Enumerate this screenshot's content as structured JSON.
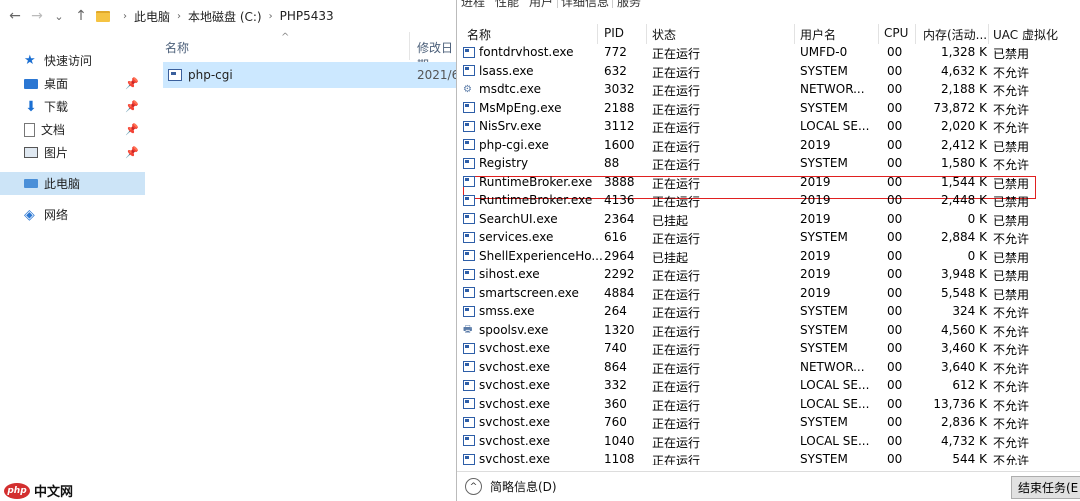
{
  "explorer": {
    "nav_back": "←",
    "nav_forward": "→",
    "nav_dropdown": "⌄",
    "nav_up": "↑",
    "breadcrumb": [
      "此电脑",
      "本地磁盘 (C:)",
      "PHP5433"
    ],
    "breadcrumb_sep": "›",
    "sidebar": [
      {
        "label": "快速访问",
        "icon": "star-icon"
      },
      {
        "label": "桌面",
        "icon": "desktop-icon",
        "pinned": true
      },
      {
        "label": "下载",
        "icon": "download-icon",
        "pinned": true
      },
      {
        "label": "文档",
        "icon": "document-icon",
        "pinned": true
      },
      {
        "label": "图片",
        "icon": "picture-icon",
        "pinned": true
      },
      {
        "label": "此电脑",
        "icon": "computer-icon",
        "selected": true
      },
      {
        "label": "网络",
        "icon": "network-icon"
      }
    ],
    "columns": {
      "name": "名称",
      "date": "修改日期"
    },
    "sort_indicator": "^",
    "pin_glyph": "📌",
    "files": [
      {
        "name": "php-cgi",
        "date": "2021/6"
      }
    ]
  },
  "taskmgr": {
    "tabs": [
      "进程",
      "性能",
      "用户",
      "详细信息",
      "服务"
    ],
    "active_tab": "详细信息",
    "columns": [
      "名称",
      "PID",
      "状态",
      "用户名",
      "CPU",
      "内存(活动...",
      "UAC 虚拟化"
    ],
    "rows": [
      {
        "name": "fontdrvhost.exe",
        "pid": "772",
        "status": "正在运行",
        "user": "UMFD-0",
        "cpu": "00",
        "mem": "1,328 K",
        "uac": "已禁用",
        "icon": "process-icon"
      },
      {
        "name": "lsass.exe",
        "pid": "632",
        "status": "正在运行",
        "user": "SYSTEM",
        "cpu": "00",
        "mem": "4,632 K",
        "uac": "不允许",
        "icon": "process-icon"
      },
      {
        "name": "msdtc.exe",
        "pid": "3032",
        "status": "正在运行",
        "user": "NETWOR...",
        "cpu": "00",
        "mem": "2,188 K",
        "uac": "不允许",
        "icon": "service-icon"
      },
      {
        "name": "MsMpEng.exe",
        "pid": "2188",
        "status": "正在运行",
        "user": "SYSTEM",
        "cpu": "00",
        "mem": "73,872 K",
        "uac": "不允许",
        "icon": "process-icon"
      },
      {
        "name": "NisSrv.exe",
        "pid": "3112",
        "status": "正在运行",
        "user": "LOCAL SE...",
        "cpu": "00",
        "mem": "2,020 K",
        "uac": "不允许",
        "icon": "process-icon"
      },
      {
        "name": "php-cgi.exe",
        "pid": "1600",
        "status": "正在运行",
        "user": "2019",
        "cpu": "00",
        "mem": "2,412 K",
        "uac": "已禁用",
        "icon": "process-icon",
        "highlighted": true
      },
      {
        "name": "Registry",
        "pid": "88",
        "status": "正在运行",
        "user": "SYSTEM",
        "cpu": "00",
        "mem": "1,580 K",
        "uac": "不允许",
        "icon": "process-icon"
      },
      {
        "name": "RuntimeBroker.exe",
        "pid": "3888",
        "status": "正在运行",
        "user": "2019",
        "cpu": "00",
        "mem": "1,544 K",
        "uac": "已禁用",
        "icon": "process-icon"
      },
      {
        "name": "RuntimeBroker.exe",
        "pid": "4136",
        "status": "正在运行",
        "user": "2019",
        "cpu": "00",
        "mem": "2,448 K",
        "uac": "已禁用",
        "icon": "process-icon"
      },
      {
        "name": "SearchUI.exe",
        "pid": "2364",
        "status": "已挂起",
        "user": "2019",
        "cpu": "00",
        "mem": "0 K",
        "uac": "已禁用",
        "icon": "process-icon"
      },
      {
        "name": "services.exe",
        "pid": "616",
        "status": "正在运行",
        "user": "SYSTEM",
        "cpu": "00",
        "mem": "2,884 K",
        "uac": "不允许",
        "icon": "process-icon"
      },
      {
        "name": "ShellExperienceHo...",
        "pid": "2964",
        "status": "已挂起",
        "user": "2019",
        "cpu": "00",
        "mem": "0 K",
        "uac": "已禁用",
        "icon": "process-icon"
      },
      {
        "name": "sihost.exe",
        "pid": "2292",
        "status": "正在运行",
        "user": "2019",
        "cpu": "00",
        "mem": "3,948 K",
        "uac": "已禁用",
        "icon": "process-icon"
      },
      {
        "name": "smartscreen.exe",
        "pid": "4884",
        "status": "正在运行",
        "user": "2019",
        "cpu": "00",
        "mem": "5,548 K",
        "uac": "已禁用",
        "icon": "process-icon"
      },
      {
        "name": "smss.exe",
        "pid": "264",
        "status": "正在运行",
        "user": "SYSTEM",
        "cpu": "00",
        "mem": "324 K",
        "uac": "不允许",
        "icon": "process-icon"
      },
      {
        "name": "spoolsv.exe",
        "pid": "1320",
        "status": "正在运行",
        "user": "SYSTEM",
        "cpu": "00",
        "mem": "4,560 K",
        "uac": "不允许",
        "icon": "printer-icon"
      },
      {
        "name": "svchost.exe",
        "pid": "740",
        "status": "正在运行",
        "user": "SYSTEM",
        "cpu": "00",
        "mem": "3,460 K",
        "uac": "不允许",
        "icon": "process-icon"
      },
      {
        "name": "svchost.exe",
        "pid": "864",
        "status": "正在运行",
        "user": "NETWOR...",
        "cpu": "00",
        "mem": "3,640 K",
        "uac": "不允许",
        "icon": "process-icon"
      },
      {
        "name": "svchost.exe",
        "pid": "332",
        "status": "正在运行",
        "user": "LOCAL SE...",
        "cpu": "00",
        "mem": "612 K",
        "uac": "不允许",
        "icon": "process-icon"
      },
      {
        "name": "svchost.exe",
        "pid": "360",
        "status": "正在运行",
        "user": "LOCAL SE...",
        "cpu": "00",
        "mem": "13,736 K",
        "uac": "不允许",
        "icon": "process-icon"
      },
      {
        "name": "svchost.exe",
        "pid": "760",
        "status": "正在运行",
        "user": "SYSTEM",
        "cpu": "00",
        "mem": "2,836 K",
        "uac": "不允许",
        "icon": "process-icon"
      },
      {
        "name": "svchost.exe",
        "pid": "1040",
        "status": "正在运行",
        "user": "LOCAL SE...",
        "cpu": "00",
        "mem": "4,732 K",
        "uac": "不允许",
        "icon": "process-icon"
      },
      {
        "name": "svchost.exe",
        "pid": "1108",
        "status": "正在运行",
        "user": "SYSTEM",
        "cpu": "00",
        "mem": "544 K",
        "uac": "不允许",
        "icon": "process-icon"
      }
    ],
    "fewer_details_label": "简略信息(D)",
    "fewer_details_glyph": "^",
    "end_task_label": "结束任务(E"
  },
  "watermark": {
    "logo": "php",
    "text": "中文网"
  },
  "colors": {
    "highlight_border": "#e02020",
    "selection": "#cce8ff",
    "nav_selected": "#cce4f7"
  }
}
